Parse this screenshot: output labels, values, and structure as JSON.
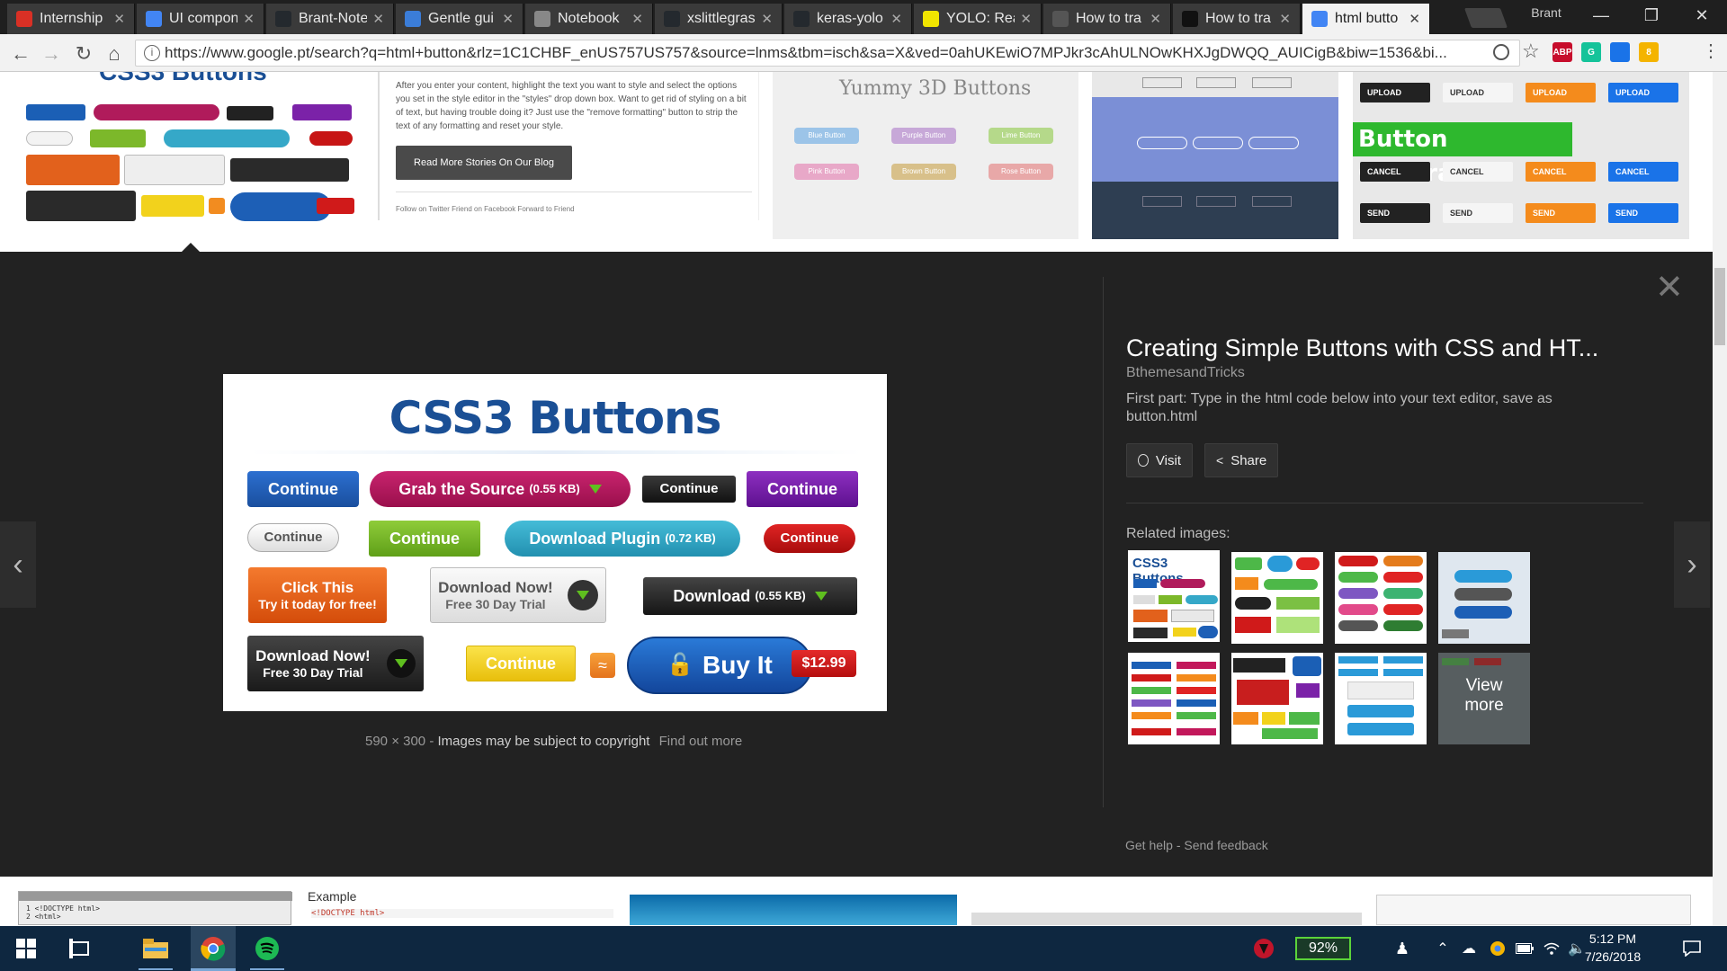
{
  "browser": {
    "tabs": [
      {
        "label": "Internship",
        "icon": "gmail-icon",
        "color": "#d93025"
      },
      {
        "label": "UI compon",
        "icon": "docs-icon",
        "color": "#4285f4"
      },
      {
        "label": "Brant-Note",
        "icon": "github-icon",
        "color": "#24292e"
      },
      {
        "label": "Gentle gui",
        "icon": "blog-icon",
        "color": "#3b7dd8"
      },
      {
        "label": "Notebook",
        "icon": "document-icon",
        "color": "#888888"
      },
      {
        "label": "xslittlegras",
        "icon": "github-icon",
        "color": "#24292e"
      },
      {
        "label": "keras-yolo",
        "icon": "github-icon",
        "color": "#24292e"
      },
      {
        "label": "YOLO: Real",
        "icon": "pjreddie-icon",
        "color": "#f2e600"
      },
      {
        "label": "How to tra",
        "icon": "loading-icon",
        "color": "#555555"
      },
      {
        "label": "How to tra",
        "icon": "medium-icon",
        "color": "#111111"
      },
      {
        "label": "html butto",
        "icon": "google-icon",
        "color": "#4285f4"
      }
    ],
    "active_tab_index": 10,
    "profile_name": "Brant",
    "url": "https://www.google.pt/search?q=html+button&rlz=1C1CHBF_enUS757US757&source=lnms&tbm=isch&sa=X&ved=0ahUKEwiO7MPJkr3cAhULNOwKHXJgDWQQ_AUICigB&biw=1536&bi...",
    "extensions": [
      {
        "name": "adblock-icon",
        "label": "ABP",
        "color": "#c70d2c"
      },
      {
        "name": "grammarly-icon",
        "label": "G",
        "color": "#15c39a"
      },
      {
        "name": "bookmark-ext-icon",
        "label": "",
        "color": "#1a73e8"
      },
      {
        "name": "notes-ext-icon",
        "label": "8",
        "color": "#f4b400"
      }
    ]
  },
  "top_strip": {
    "blog_text": "After you enter your content, highlight the text you want to style and select the options you set in the style editor in the \"styles\" drop down box. Want to get rid of styling on a bit of text, but having trouble doing it? Just use the \"remove formatting\" button to strip the text of any formatting and reset your style.",
    "blog_button": "Read More Stories On Our Blog",
    "blog_footer": "Follow on Twitter   Friend on Facebook   Forward to Friend",
    "yummy_title": "Yummy 3D Buttons",
    "yummy_buttons": [
      "Blue Button",
      "Purple Button",
      "Lime Button",
      "Pink Button",
      "Brown Button",
      "Rose Button"
    ],
    "generator_title": "Button Generator",
    "generator_rows": [
      [
        "UPLOAD",
        "UPLOAD",
        "UPLOAD",
        "UPLOAD"
      ],
      [
        "CANCEL",
        "CANCEL",
        "CANCEL",
        "CANCEL"
      ],
      [
        "SEND",
        "SEND",
        "SEND",
        "SEND"
      ]
    ]
  },
  "main_image": {
    "title": "CSS3 Buttons",
    "buttons": {
      "continue_blue": "Continue",
      "grab_source": "Grab the Source",
      "grab_size": "(0.55 KB)",
      "continue_black": "Continue",
      "continue_purple": "Continue",
      "continue_white": "Continue",
      "continue_green": "Continue",
      "download_plugin": "Download Plugin",
      "plugin_size": "(0.72 KB)",
      "continue_red": "Continue",
      "click_this": "Click This",
      "try_free": "Try it today for free!",
      "download_now": "Download Now!",
      "free_trial": "Free 30 Day Trial",
      "download": "Download",
      "download_size": "(0.55 KB)",
      "download_now_2": "Download Now!",
      "free_trial_2": "Free 30 Day Trial",
      "continue_yellow": "Continue",
      "buy_it": "Buy It",
      "price": "$12.99"
    },
    "caption_size": "590 × 300",
    "caption_sep": " - ",
    "caption_copyright": "Images may be subject to copyright",
    "caption_link": "Find out more"
  },
  "details": {
    "title": "Creating Simple Buttons with CSS and HT...",
    "source": "BthemesandTricks",
    "description": "First part: Type in the html code below into your text editor, save as button.html",
    "visit_label": "Visit",
    "share_label": "Share",
    "related_label": "Related images:",
    "thumb_1_text": "CSS3 Buttons",
    "view_more_1": "View",
    "view_more_2": "more",
    "get_help": "Get help",
    "separator": " - ",
    "send_feedback": "Send feedback"
  },
  "bottom_strip": {
    "example_label": "Example",
    "code_line": "<!DOCTYPE html>"
  },
  "taskbar": {
    "battery": "92%",
    "time": "5:12 PM",
    "date": "7/26/2018"
  }
}
